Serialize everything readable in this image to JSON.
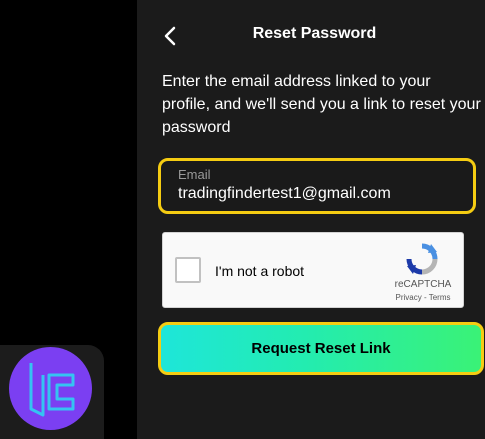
{
  "header": {
    "title": "Reset Password",
    "back_icon": "chevron-left-icon"
  },
  "description": "Enter the email address linked to your profile, and we'll send you a link to reset your password",
  "email": {
    "label": "Email",
    "value": "tradingfindertest1@gmail.com"
  },
  "captcha": {
    "label": "I'm not a robot",
    "brand": "reCAPTCHA",
    "privacy": "Privacy",
    "separator": " - ",
    "terms": "Terms"
  },
  "submit": {
    "label": "Request Reset Link"
  },
  "colors": {
    "highlight": "#f5cc12",
    "gradient_start": "#1ee6d9",
    "gradient_end": "#3af276",
    "logo_bg": "#7b3ff2",
    "logo_stroke": "#35c3f2"
  },
  "logo_icon": "tradingfinder-logo-icon"
}
